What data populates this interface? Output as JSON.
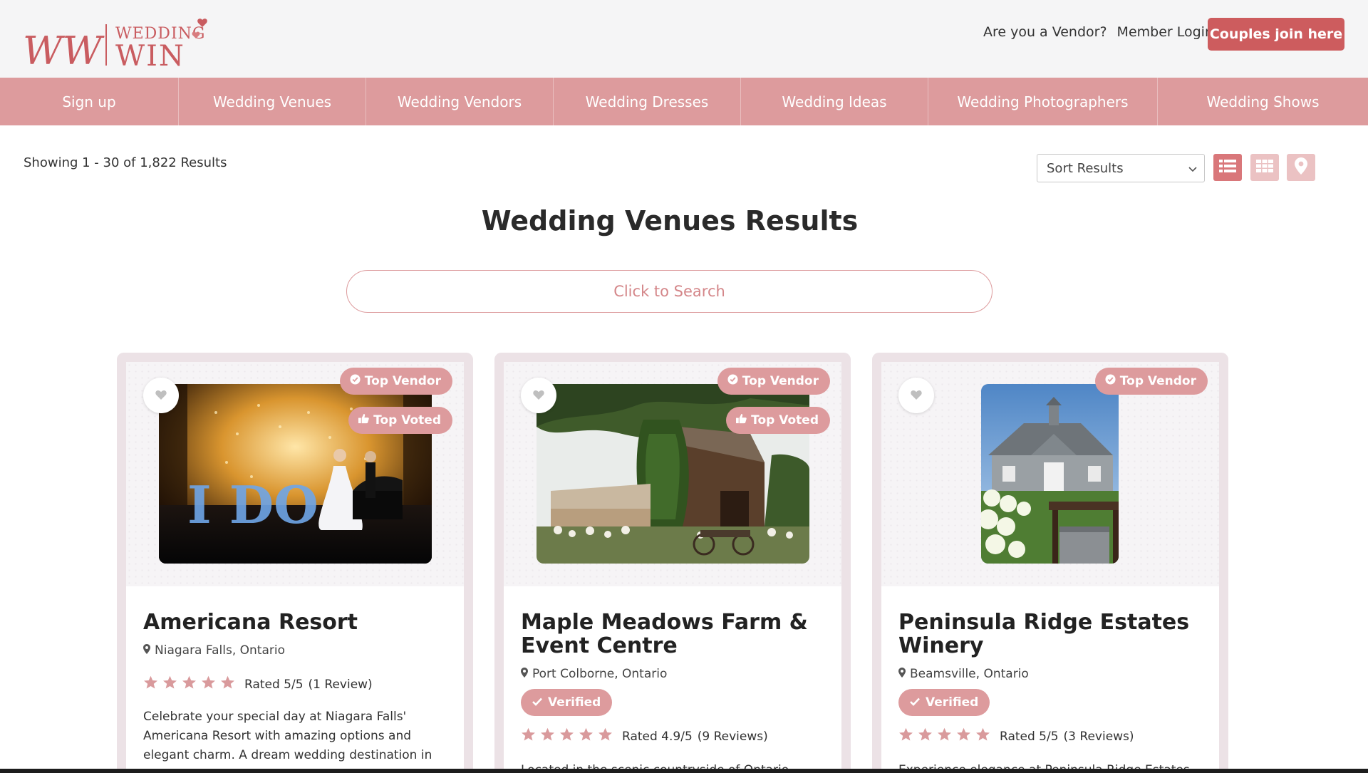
{
  "header": {
    "logo_monogram": "WW",
    "logo_line1": "WEDDING",
    "logo_line2": "WIN",
    "vendor_link": "Are you a Vendor?",
    "member_login": "Member Login",
    "join_button": "Couples join here"
  },
  "nav": {
    "items": [
      {
        "label": "Sign up"
      },
      {
        "label": "Wedding Venues"
      },
      {
        "label": "Wedding Vendors"
      },
      {
        "label": "Wedding Dresses"
      },
      {
        "label": "Wedding Ideas"
      },
      {
        "label": "Wedding Photographers"
      },
      {
        "label": "Wedding Shows"
      }
    ]
  },
  "toolbar": {
    "showing": "Showing 1 - 30 of 1,822 Results",
    "sort_label": "Sort Results",
    "views": [
      "list-view-icon",
      "grid-view-icon",
      "map-view-icon"
    ]
  },
  "page_title": "Wedding Venues Results",
  "search": {
    "placeholder": "Click to Search"
  },
  "colors": {
    "brand": "#dd9b9d",
    "button": "#cd5c5e",
    "star": "#d99a9c"
  },
  "cards": [
    {
      "title": "Americana Resort",
      "location": "Niagara Falls, Ontario",
      "badges": [
        "Top Vendor",
        "Top Voted"
      ],
      "verified": "",
      "rating_text": "Rated 5/5",
      "reviews": "(1 Review)",
      "rating": 5,
      "description": "Celebrate your special day at Niagara Falls' Americana Resort with amazing options and elegant charm. A dream wedding destination in Ontario,",
      "photo_text": "I DO"
    },
    {
      "title": "Maple Meadows Farm & Event Centre",
      "location": "Port Colborne, Ontario",
      "badges": [
        "Top Vendor",
        "Top Voted"
      ],
      "verified": "Verified",
      "rating_text": "Rated 4.9/5",
      "reviews": "(9 Reviews)",
      "rating": 4.9,
      "description": "Located in the scenic countryside of Ontario, Maple"
    },
    {
      "title": "Peninsula Ridge Estates Winery",
      "location": "Beamsville, Ontario",
      "badges": [
        "Top Vendor"
      ],
      "verified": "Verified",
      "rating_text": "Rated 5/5",
      "reviews": "(3 Reviews)",
      "rating": 5,
      "description": "Experience elegance at Peninsula Ridge Estates"
    }
  ]
}
